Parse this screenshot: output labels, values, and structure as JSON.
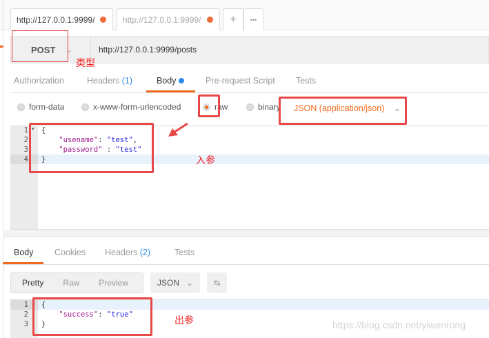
{
  "tabs": [
    {
      "label": "http://127.0.0.1:9999/"
    },
    {
      "label": "http://127.0.0.1:9999/"
    }
  ],
  "tab_actions": {
    "add": "+",
    "more": "•••"
  },
  "request": {
    "method": "POST",
    "url": "http://127.0.0.1:9999/posts"
  },
  "request_tabs": {
    "authorization": "Authorization",
    "headers": "Headers",
    "headers_count": "(1)",
    "body": "Body",
    "prerequest": "Pre-request Script",
    "tests": "Tests"
  },
  "body_modes": {
    "form_data": "form-data",
    "urlencoded": "x-www-form-urlencoded",
    "raw": "raw",
    "binary": "binary",
    "content_type": "JSON (application/json)"
  },
  "request_body": {
    "line_numbers": [
      "1",
      "2",
      "3",
      "4"
    ],
    "lines": [
      "{",
      "    \"usename\": \"test\",",
      "    \"password\" : \"test\"",
      "}"
    ]
  },
  "annotations": {
    "type": "类型",
    "input": "入参",
    "output": "出参"
  },
  "response_tabs": {
    "body": "Body",
    "cookies": "Cookies",
    "headers": "Headers",
    "headers_count": "(2)",
    "tests": "Tests"
  },
  "response_view": {
    "pretty": "Pretty",
    "raw": "Raw",
    "preview": "Preview",
    "format": "JSON"
  },
  "response_body": {
    "line_numbers": [
      "1",
      "2",
      "3"
    ],
    "lines": [
      "{",
      "    \"success\": \"true\"",
      "}"
    ]
  },
  "watermark": "https://blog.csdn.net/yiwenrong",
  "colors": {
    "accent": "#f26b1d",
    "annotation": "#e84848",
    "link": "#2c8be8"
  }
}
